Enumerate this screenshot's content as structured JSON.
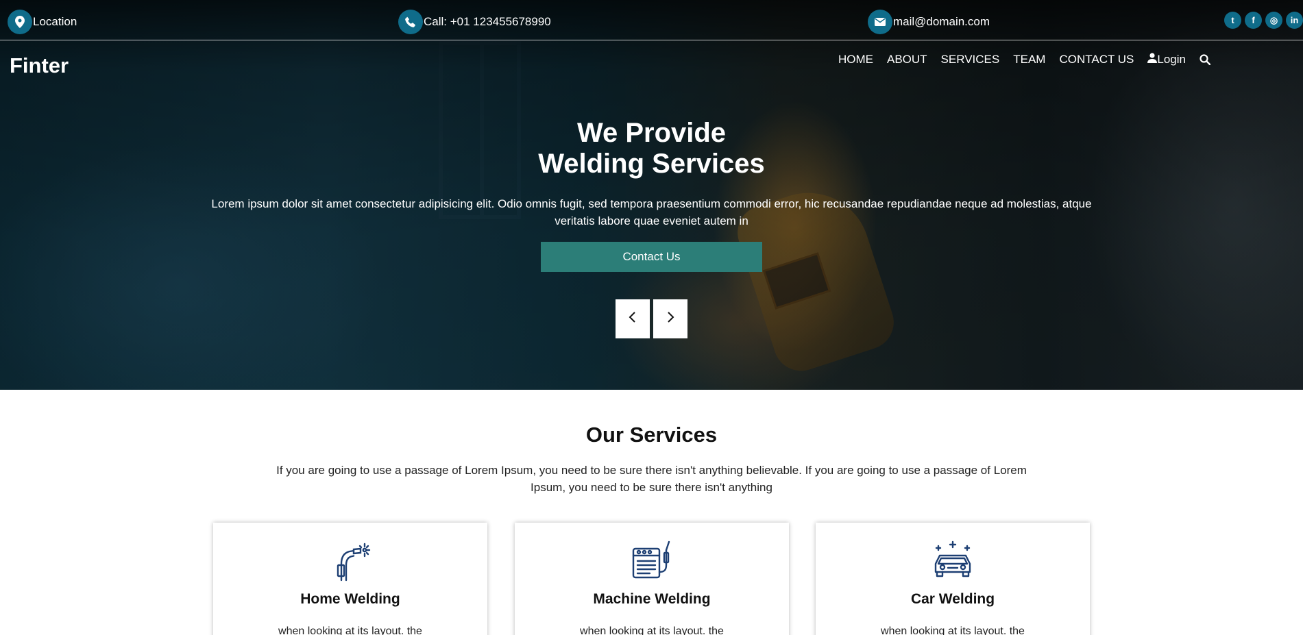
{
  "topbar": {
    "location": "Location",
    "call": "Call: +01 123455678990",
    "email": "mail@domain.com",
    "socials": [
      {
        "name": "twitter-icon",
        "glyph": "t"
      },
      {
        "name": "facebook-icon",
        "glyph": "f"
      },
      {
        "name": "instagram-icon",
        "glyph": "◎"
      },
      {
        "name": "linkedin-icon",
        "glyph": "in"
      }
    ]
  },
  "nav": {
    "brand": "Finter",
    "items": [
      "HOME",
      "ABOUT",
      "SERVICES",
      "TEAM",
      "CONTACT US"
    ],
    "login": "Login"
  },
  "hero": {
    "title_line1": "We Provide",
    "title_line2": "Welding Services",
    "text": "Lorem ipsum dolor sit amet consectetur adipisicing elit. Odio omnis fugit, sed tempora praesentium commodi error, hic recusandae repudiandae neque ad molestias, atque veritatis labore quae eveniet autem in",
    "cta": "Contact Us"
  },
  "services": {
    "title": "Our Services",
    "text": "If you are going to use a passage of Lorem Ipsum, you need to be sure there isn't anything believable. If you are going to use a passage of Lorem Ipsum, you need to be sure there isn't anything",
    "cards": [
      {
        "title": "Home Welding",
        "text": "when looking at its layout. the",
        "icon": "welding-torch-icon"
      },
      {
        "title": "Machine Welding",
        "text": "when looking at its layout. the",
        "icon": "welding-machine-icon"
      },
      {
        "title": "Car Welding",
        "text": "when looking at its layout. the",
        "icon": "car-icon"
      }
    ]
  },
  "colors": {
    "accent": "#0f6c8a",
    "cta": "#2c7e78",
    "icon": "#1d3f73"
  }
}
